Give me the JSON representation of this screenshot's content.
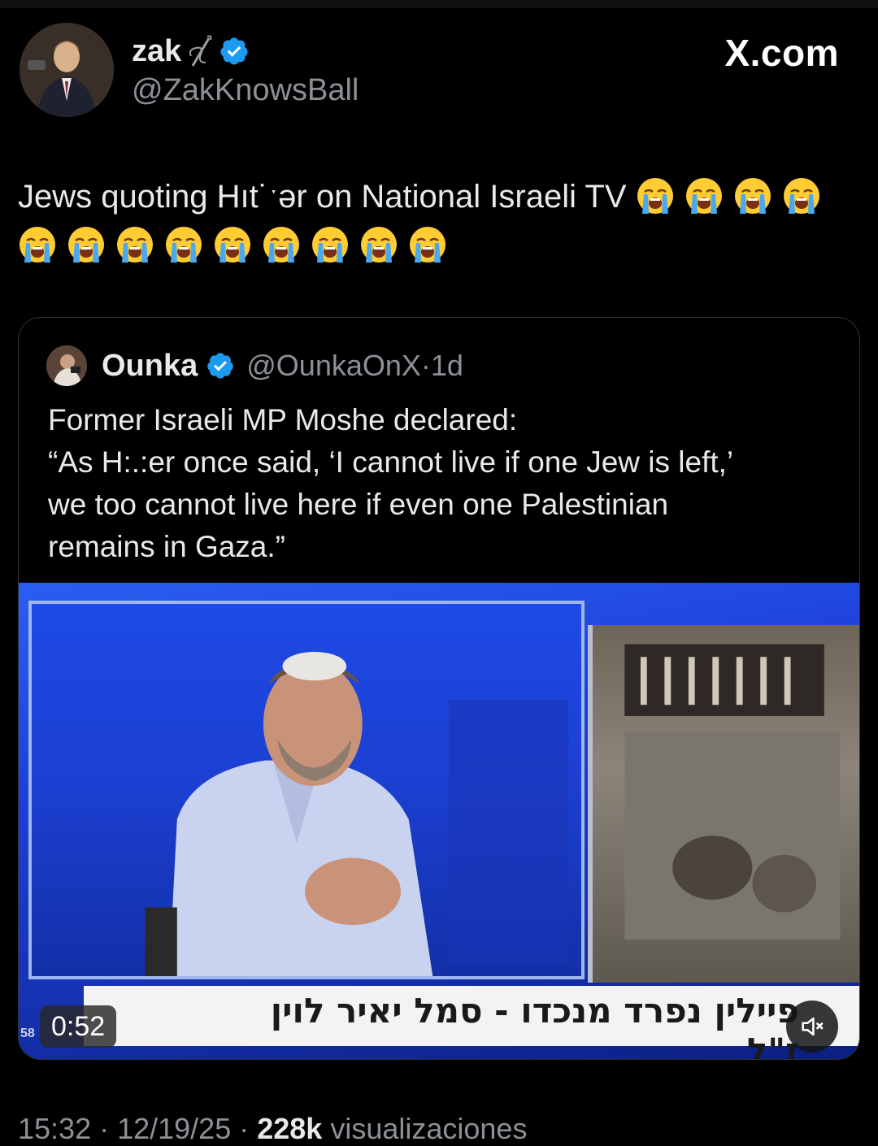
{
  "brand": "X.com",
  "author": {
    "display_name": "zak",
    "handle": "@ZakKnowsBall"
  },
  "tweet": {
    "text": "Jews quoting Hıt˙ˑər on National Israeli TV",
    "emoji_count": 13,
    "emoji_name": "loudly-crying-face"
  },
  "quoted": {
    "display_name": "Ounka",
    "handle": "@OunkaOnX",
    "separator": "·",
    "age": "1d",
    "text": "Former Israeli MP Moshe declared:\n“As H:.:er once said, ‘I cannot live if one Jew is left,’\nwe too cannot live here if even one Palestinian\nremains in Gaza.”",
    "video": {
      "chyron": "פיילין נפרד מנכדו - סמל יאיר לוין ז\"ל",
      "corner_number": "58",
      "duration": "0:52",
      "muted": true
    }
  },
  "meta": {
    "time": "15:32",
    "sep1": " · ",
    "date": "12/19/25",
    "sep2": " · ",
    "views_count": "228k",
    "views_label": " visualizaciones"
  },
  "colors": {
    "background": "#000000",
    "text": "#e7e9ea",
    "muted": "#8b9197",
    "verified": "#1d9bf0",
    "border": "#2f3336"
  }
}
